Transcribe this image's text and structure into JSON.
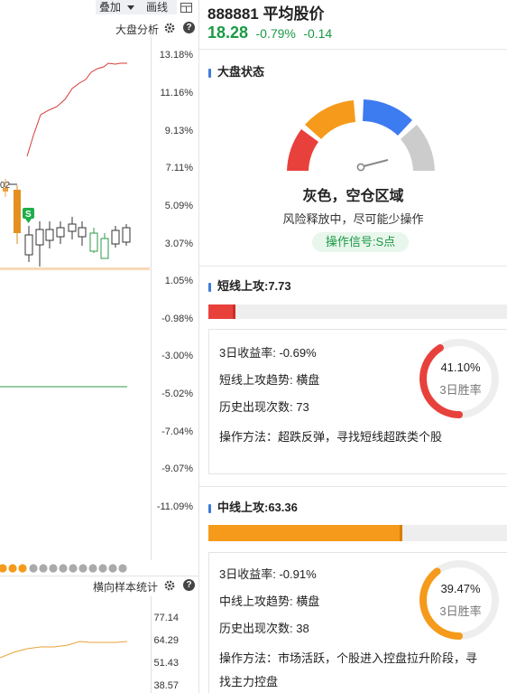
{
  "left_panel": {
    "toolbar": {
      "overlay_label": "叠加",
      "draw_label": "画线"
    },
    "market_analysis_label": "大盘分析",
    "y_axis_labels": [
      "13.18%",
      "11.16%",
      "9.13%",
      "7.11%",
      "5.09%",
      "3.07%",
      "1.05%",
      "-0.98%",
      "-3.00%",
      "-5.02%",
      "-7.04%",
      "-9.07%",
      "-11.09%"
    ],
    "signal_badge": "S",
    "price_tag": "02",
    "cross_stats_label": "横向样本统计",
    "bottom_axis_labels": [
      "77.14",
      "64.29",
      "51.43",
      "38.57"
    ]
  },
  "header": {
    "code_name": "888881 平均股价",
    "price": "18.28",
    "pct": "-0.79%",
    "change": "-0.14"
  },
  "market_status": {
    "title": "大盘状态",
    "state_title": "灰色，空仓区域",
    "state_desc": "风险释放中，尽可能少操作",
    "signal_pill": "操作信号:S点"
  },
  "short_attack": {
    "title": "短线上攻:7.73",
    "progress": 0.088,
    "return_label": "3日收益率: ",
    "return_value": "-0.69%",
    "trend_label": "短线上攻趋势: ",
    "trend_value": "横盘",
    "count_label": "历史出现次数: ",
    "count_value": "73",
    "method": "操作方法：超跌反弹，寻找短线超跌类个股",
    "win_rate": "41.10%",
    "win_rate_value": 0.411,
    "win_label": "3日胜率"
  },
  "mid_attack": {
    "title": "中线上攻:63.36",
    "progress": 0.6336,
    "return_label": "3日收益率: ",
    "return_value": "-0.91%",
    "trend_label": "中线上攻趋势: ",
    "trend_value": "横盘",
    "count_label": "历史出现次数: ",
    "count_value": "38",
    "method_line1": "操作方法：市场活跃，个股进入控盘拉升阶段，寻",
    "method_line2": "找主力控盘",
    "win_rate": "39.47%",
    "win_rate_value": 0.3947,
    "win_label": "3日胜率"
  },
  "colors": {
    "red": "#e8413c",
    "orange": "#f59a1a",
    "blue": "#3d7bf0",
    "gray": "#cccccc",
    "green": "#1a9a45"
  }
}
